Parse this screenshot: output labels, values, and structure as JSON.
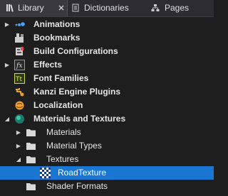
{
  "tabs": [
    {
      "label": "Library",
      "icon": "library-icon",
      "active": true
    },
    {
      "label": "Dictionaries",
      "icon": "dictionary-icon",
      "active": false
    },
    {
      "label": "Pages",
      "icon": "pages-icon",
      "active": false
    }
  ],
  "tree": {
    "items": [
      {
        "label": "Animations",
        "icon": "animation-icon",
        "expander": "collapsed",
        "bold": true
      },
      {
        "label": "Bookmarks",
        "icon": "bookmark-icon",
        "expander": "none",
        "bold": true
      },
      {
        "label": "Build Configurations",
        "icon": "build-config-icon",
        "expander": "none",
        "bold": true
      },
      {
        "label": "Effects",
        "icon": "effects-icon",
        "expander": "collapsed",
        "bold": true
      },
      {
        "label": "Font Families",
        "icon": "font-icon",
        "expander": "none",
        "bold": true
      },
      {
        "label": "Kanzi Engine Plugins",
        "icon": "plugin-icon",
        "expander": "none",
        "bold": true
      },
      {
        "label": "Localization",
        "icon": "localization-icon",
        "expander": "none",
        "bold": true
      },
      {
        "label": "Materials and Textures",
        "icon": "materials-icon",
        "expander": "expanded",
        "bold": true
      },
      {
        "label": "Materials",
        "icon": "folder-icon",
        "expander": "collapsed",
        "bold": false
      },
      {
        "label": "Material Types",
        "icon": "folder-icon",
        "expander": "collapsed",
        "bold": false
      },
      {
        "label": "Textures",
        "icon": "folder-icon",
        "expander": "expanded",
        "bold": false
      },
      {
        "label": "RoadTexture",
        "icon": "texture-icon",
        "expander": "none",
        "bold": false,
        "selected": true
      },
      {
        "label": "Shader Formats",
        "icon": "folder-icon",
        "expander": "none",
        "bold": false
      }
    ]
  },
  "colors": {
    "selection": "#1976d2",
    "background": "#1e1e1e",
    "folder": "#d8d8d8"
  }
}
